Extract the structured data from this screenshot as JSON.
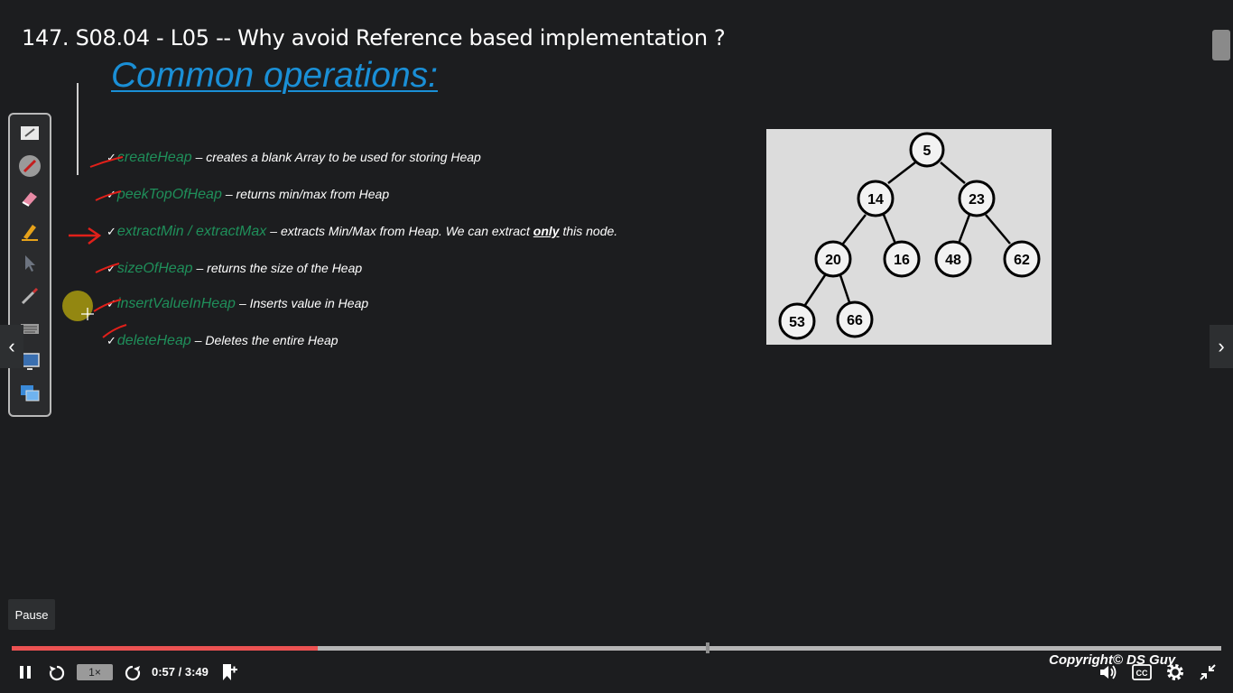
{
  "video_title": "147. S08.04 - L05 -- Why avoid Reference based implementation ?",
  "slide": {
    "heading": "Common operations:",
    "operations": [
      {
        "name": "createHeap",
        "desc": "– creates a blank Array to be used for storing Heap"
      },
      {
        "name": "peekTopOfHeap",
        "desc": "– returns min/max from Heap"
      },
      {
        "name": "extractMin / extractMax",
        "desc_before": "– extracts Min/Max from Heap. We can extract ",
        "desc_bold": "only",
        "desc_after": " this node."
      },
      {
        "name": "sizeOfHeap",
        "desc": "– returns the size of the Heap"
      },
      {
        "name": "insertValueInHeap",
        "desc": "– Inserts value in Heap"
      },
      {
        "name": "deleteHeap",
        "desc": "– Deletes the entire Heap"
      }
    ],
    "check_mark": "✓"
  },
  "heap_tree": {
    "nodes": [
      "5",
      "14",
      "23",
      "20",
      "16",
      "48",
      "62",
      "53",
      "66"
    ]
  },
  "tool_palette": {
    "tools": [
      "whiteboard-icon",
      "pen-icon",
      "eraser-icon",
      "highlighter-icon",
      "pointer-icon",
      "brush-icon",
      "keyboard-icon",
      "screen-icon",
      "presentation-icon"
    ]
  },
  "player": {
    "pause_tooltip": "Pause",
    "speed": "1×",
    "current_time": "0:57",
    "duration": "3:49",
    "time_separator": " / ",
    "progress_fraction": 0.253,
    "copyright": "Copyright© DS Guy"
  },
  "colors": {
    "accent_blue": "#1a8fd6",
    "op_green": "#1f8f5a",
    "progress_red": "#ec5252",
    "annotation_red": "#e0201a"
  }
}
